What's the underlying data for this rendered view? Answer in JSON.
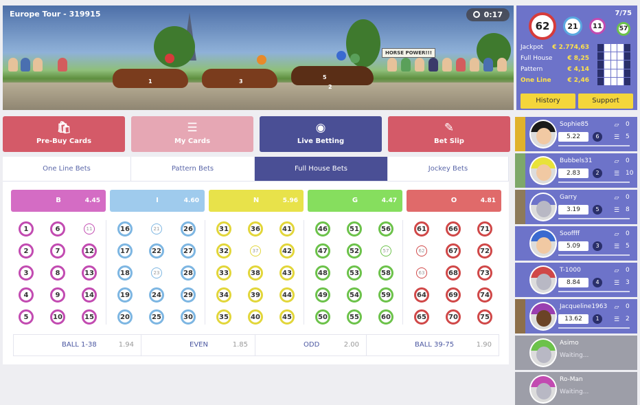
{
  "header": {
    "title": "Europe Tour - 319915",
    "timer": "0:17",
    "sign": "HORSE POWER!!!"
  },
  "horses": [
    {
      "number": "1"
    },
    {
      "number": "3"
    },
    {
      "number": "5"
    },
    {
      "number": "2"
    }
  ],
  "info": {
    "ball_count": "7/75",
    "balls": [
      {
        "label": "62",
        "color": "#d63b3b"
      },
      {
        "label": "21",
        "color": "#5aa9e0"
      },
      {
        "label": "11",
        "color": "#c24bb1"
      },
      {
        "label": "57",
        "color": "#6cc24a"
      }
    ],
    "prizes": [
      {
        "label": "Jackpot",
        "value": "€ 2.774,63",
        "highlight": false
      },
      {
        "label": "Full House",
        "value": "€ 8,25",
        "highlight": false
      },
      {
        "label": "Pattern",
        "value": "€ 4,14",
        "highlight": false
      },
      {
        "label": "One Line",
        "value": "€ 2,46",
        "highlight": true
      }
    ],
    "history_label": "History",
    "support_label": "Support"
  },
  "top_tabs": [
    {
      "label": "Pre-Buy Cards",
      "icon": "shopping-bag-icon",
      "color": "#d45a68"
    },
    {
      "label": "My Cards",
      "icon": "layers-icon",
      "color": "#e6a7b4"
    },
    {
      "label": "Live Betting",
      "icon": "coin-bag-icon",
      "color": "#4a4f95"
    },
    {
      "label": "Bet Slip",
      "icon": "slip-icon",
      "color": "#d45a68"
    }
  ],
  "sub_tabs": [
    {
      "label": "One Line Bets",
      "active": false
    },
    {
      "label": "Pattern Bets",
      "active": false
    },
    {
      "label": "Full House Bets",
      "active": true
    },
    {
      "label": "Jockey Bets",
      "active": false
    }
  ],
  "columns": [
    {
      "letter": "B",
      "odds": "4.45",
      "color": "#d46cc4",
      "ring": "#c24bb1",
      "numbers": [
        1,
        2,
        3,
        4,
        5,
        6,
        7,
        8,
        9,
        10,
        11,
        12,
        13,
        14,
        15
      ],
      "called": [
        11
      ]
    },
    {
      "letter": "I",
      "odds": "4.60",
      "color": "#9fcbed",
      "ring": "#7db6e2",
      "numbers": [
        16,
        17,
        18,
        19,
        20,
        21,
        22,
        23,
        24,
        25,
        26,
        27,
        28,
        29,
        30
      ],
      "called": [
        21,
        23
      ]
    },
    {
      "letter": "N",
      "odds": "5.96",
      "color": "#e8e24a",
      "ring": "#e2d63a",
      "numbers": [
        31,
        32,
        33,
        34,
        35,
        36,
        37,
        38,
        39,
        40,
        41,
        42,
        43,
        44,
        45
      ],
      "called": [
        37
      ]
    },
    {
      "letter": "G",
      "odds": "4.47",
      "color": "#86de5e",
      "ring": "#6cc24a",
      "numbers": [
        46,
        47,
        48,
        49,
        50,
        51,
        52,
        53,
        54,
        55,
        56,
        57,
        58,
        59,
        60
      ],
      "called": [
        57
      ]
    },
    {
      "letter": "O",
      "odds": "4.81",
      "color": "#e06a6a",
      "ring": "#d04848",
      "numbers": [
        61,
        62,
        63,
        64,
        65,
        66,
        67,
        68,
        69,
        70,
        71,
        72,
        73,
        74,
        75
      ],
      "called": [
        62,
        63
      ]
    }
  ],
  "bottom_bets": [
    {
      "label": "BALL 1-38",
      "odds": "1.94"
    },
    {
      "label": "EVEN",
      "odds": "1.85"
    },
    {
      "label": "ODD",
      "odds": "2.00"
    },
    {
      "label": "BALL 39-75",
      "odds": "1.90"
    }
  ],
  "players": [
    {
      "name": "Sophie85",
      "value": "5.22",
      "cards": "6",
      "wins": "0",
      "stack": "5",
      "stripe": "#e0b22c",
      "hair": "#1a1a1a",
      "face": "#f1c9a3",
      "waiting": false
    },
    {
      "name": "Bubbels31",
      "value": "2.83",
      "cards": "2",
      "wins": "0",
      "stack": "10",
      "stripe": "#7ea86a",
      "hair": "#e8e23a",
      "face": "#f1c9a3",
      "waiting": false
    },
    {
      "name": "Garry",
      "value": "3.19",
      "cards": "5",
      "wins": "0",
      "stack": "8",
      "stripe": "#8d7a5a",
      "hair": "#6d73c9",
      "face": "#b8b8c4",
      "waiting": false
    },
    {
      "name": "Sooffff",
      "value": "5.09",
      "cards": "3",
      "wins": "0",
      "stack": "5",
      "stripe": "#6d73c9",
      "hair": "#3a6ad0",
      "face": "#f1c9a3",
      "waiting": false
    },
    {
      "name": "T-1000",
      "value": "8.84",
      "cards": "4",
      "wins": "0",
      "stack": "3",
      "stripe": "#6d73c9",
      "hair": "#d04848",
      "face": "#b8b8c4",
      "waiting": false
    },
    {
      "name": "Jacqueline1963",
      "value": "13.62",
      "cards": "1",
      "wins": "0",
      "stack": "2",
      "stripe": "#8d6f4a",
      "hair": "#9a3fb0",
      "face": "#6b4326",
      "waiting": false
    },
    {
      "name": "Asimo",
      "status": "Waiting...",
      "stripe": "#9d9ea8",
      "hair": "#6cc24a",
      "face": "#b8b8c4",
      "waiting": true
    },
    {
      "name": "Ro-Man",
      "status": "Waiting...",
      "stripe": "#9d9ea8",
      "hair": "#c24bb1",
      "face": "#b8b8c4",
      "waiting": true
    }
  ]
}
